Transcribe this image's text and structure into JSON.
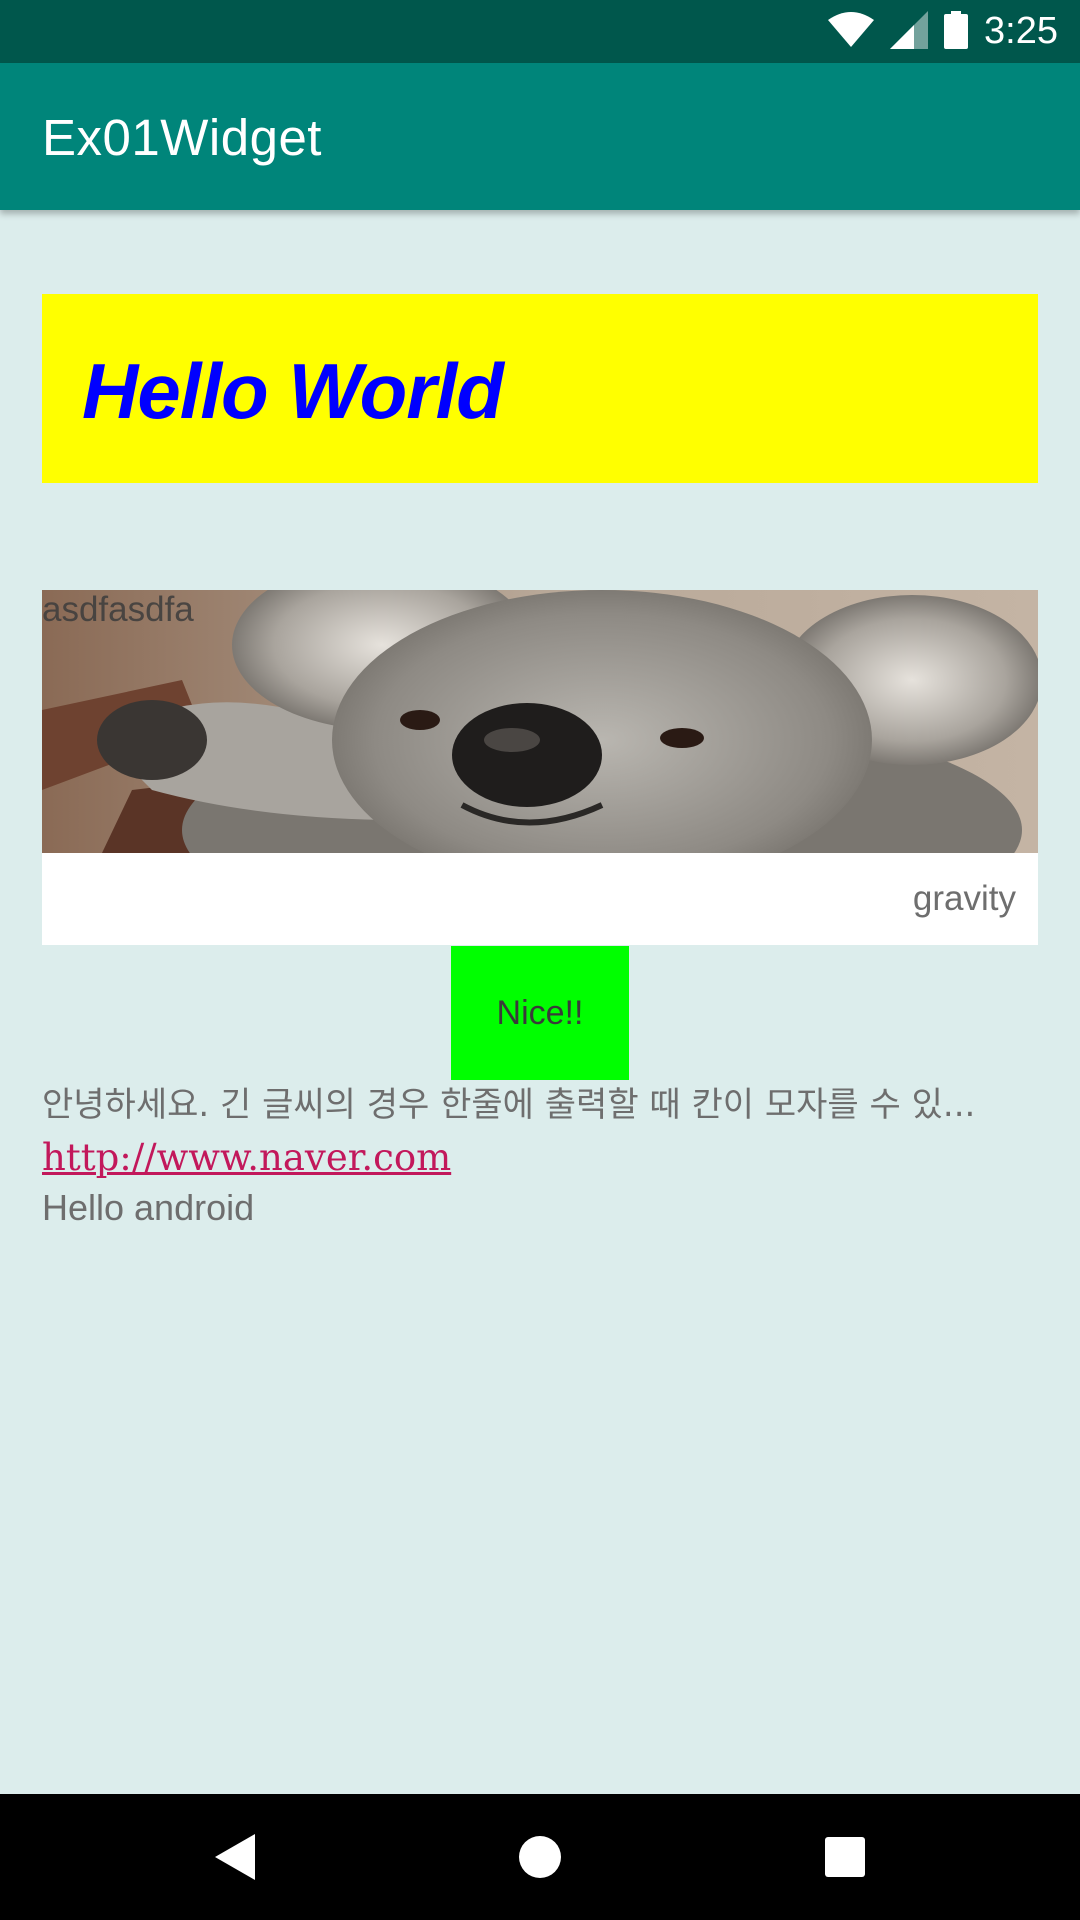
{
  "status_bar": {
    "time": "3:25",
    "icons": [
      "wifi-icon",
      "cell-signal-icon",
      "battery-icon"
    ]
  },
  "app_bar": {
    "title": "Ex01Widget",
    "color": "#00857a"
  },
  "hello_box": {
    "text": "Hello World",
    "background": "#ffff00",
    "text_color": "#0000ff"
  },
  "image_block": {
    "image": "koala-image",
    "overlay_text": "asdfasdfa",
    "gravity_text": "gravity"
  },
  "nice_button": {
    "label": "Nice!!",
    "color": "#00ff00"
  },
  "korean_text": "안녕하세요. 긴 글씨의 경우 한줄에 출력할 때 칸이 모자를 수 있...",
  "link_text": "http://www.naver.com",
  "hello_android": "Hello android",
  "nav_bar": {
    "buttons": [
      "back-icon",
      "home-icon",
      "recents-icon"
    ]
  }
}
